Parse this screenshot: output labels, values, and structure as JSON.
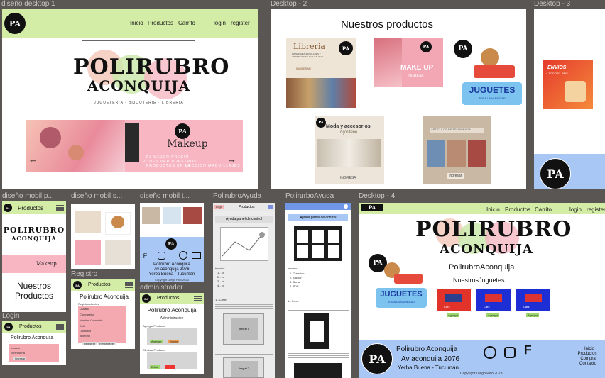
{
  "frames": {
    "desktop1": "diseño desktop 1",
    "desktop2": "Desktop - 2",
    "desktop3": "Desktop - 3",
    "mobil_p": "diseño mobil p...",
    "mobil_s": "diseño mobil s...",
    "mobil_t": "diseño mobil t...",
    "ayuda1": "PolirubroAyuda",
    "ayuda2": "PolirurboAyuda",
    "desktop4": "Desktop - 4",
    "registro": "Registro",
    "administrador": "administrador",
    "login": "Login"
  },
  "brand": {
    "logo_text": "PA",
    "title_line1": "POLIRUBRO",
    "title_line2": "ACONQUIJA",
    "subtitle": "JUGUETERIA · BIJOUTERIE · LIBRERIA"
  },
  "nav": {
    "inicio": "Inicio",
    "productos": "Productos",
    "carrito": "Carrito",
    "login": "login",
    "register": "register"
  },
  "banner": {
    "brand": "Makeup",
    "tagline1": "EL MEJOR PRECIO",
    "tagline2": "PODES VER NUESTROS",
    "tagline3": "PRODUCTOS EN LA",
    "tagline4": "SECCION MAQUILLAJES",
    "prev": "←",
    "next": "→"
  },
  "desktop2": {
    "heading": "Nuestros productos",
    "cards": [
      {
        "title": "Libreria",
        "sub": "MATERIALES ESCOLARES Y ARTISTICOS DE ALTA CALIDAD",
        "cta": "INGRESAR"
      },
      {
        "title": "MAKE UP",
        "cta": "INGRESA"
      },
      {
        "title": "JUGUETES",
        "sub": "TODA LA VARIEDAD"
      },
      {
        "title": "Moda y accesorios",
        "sub": "bijouterie",
        "cta": "INGRESA"
      },
      {
        "title": "ARTICULOS DE TEMPORADA",
        "cta": "Ingresar"
      }
    ]
  },
  "desktop3": {
    "promo_title": "ENVIOS",
    "promo_sub": "A TODO EL PAIS"
  },
  "mobile": {
    "header_title": "Productos",
    "nuestros": "Nuestros",
    "productos": "Productos"
  },
  "contact": {
    "name": "Polirubro Aconquija",
    "address": "Av aconquija 2076",
    "city": "Yerba Buena - Tucumán",
    "copyright": "Copyright Diego Pico 2023"
  },
  "registro": {
    "title": "Polirubro Aconquija",
    "subtitle": "Registro clientes",
    "fields": [
      "Usuario",
      "Contraseña",
      "Nombre Completo",
      "DNI",
      "Domicilio",
      "Telefono"
    ],
    "btn1": "Registrar",
    "btn2": "Restablecer"
  },
  "admin": {
    "title": "Polirubro Aconquija",
    "section": "Administracion",
    "label1": "Agregar Producto",
    "label2": "Eliminar Producto",
    "btn_add": "Agregar",
    "btn_clear": "Borrar",
    "btn_remove": "Editar"
  },
  "login": {
    "title": "Polirubro Aconquija",
    "user": "usuario",
    "pass": "contraseña",
    "btn": "ingresar"
  },
  "ayuda1": {
    "logo": "Logo",
    "header": "Productos",
    "panel": "Ayuda panel de control",
    "temario": "temario",
    "items": [
      "1.- xx",
      "2.- xx",
      "3.- xx",
      "4.- xx"
    ],
    "crear": "1.- Crear",
    "img1": "img el 1",
    "img2": "img el 2"
  },
  "ayuda2": {
    "panel": "Ayuda panel de control",
    "temario": "temario",
    "items": [
      "1. Creación",
      "2. Edición",
      "3. Borrar",
      "4. PDF"
    ],
    "crear": "1.- Crear"
  },
  "desktop4": {
    "store_name": "PolirubroAconquija",
    "section": "NuestrosJuguetes",
    "jug_title": "JUGUETES",
    "jug_sub": "TODA LA VARIEDAD",
    "toy_label": "Cars",
    "agregar": "Agregar",
    "footer_links": [
      "Inicio",
      "Productos",
      "Compra",
      "Contacto"
    ]
  },
  "colors": {
    "green": "#d4eda6",
    "blue": "#a9c7f5",
    "pink": "#f4a8b0"
  }
}
